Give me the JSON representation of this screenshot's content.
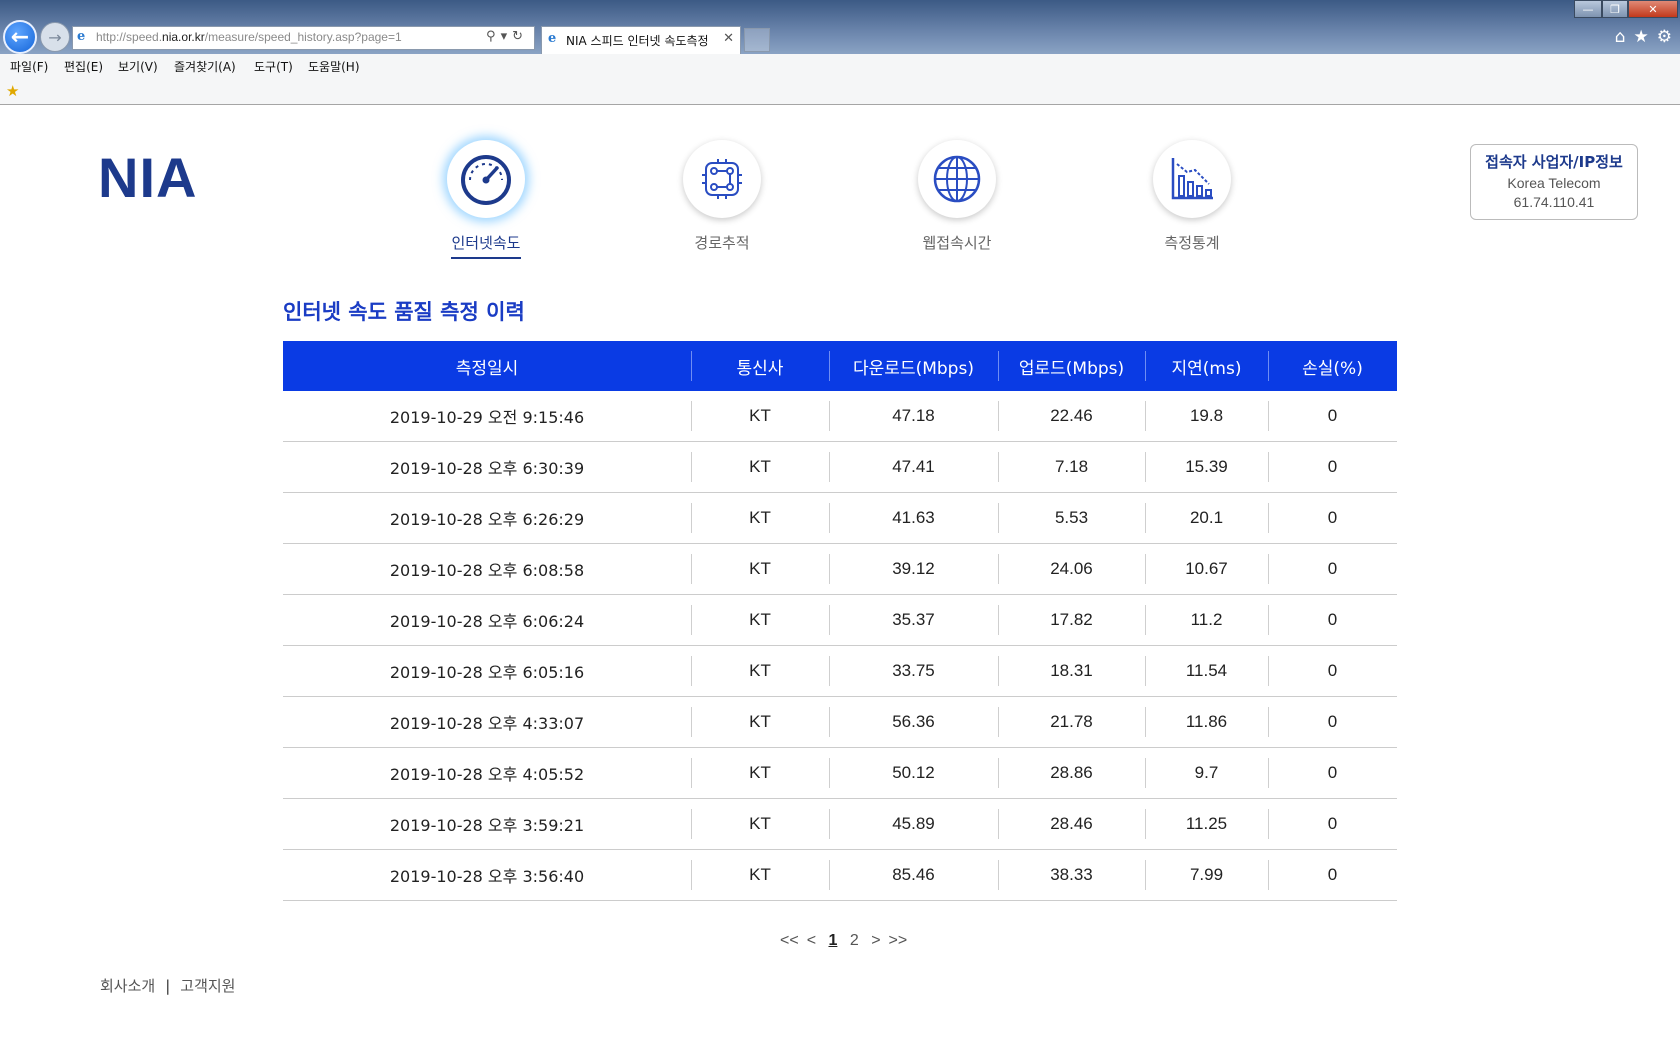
{
  "browser": {
    "url_prefix": "http://speed.",
    "url_domain": "nia.or.kr",
    "url_path": "/measure/speed_history.asp?page=1",
    "tab_title": "NIA 스피드 인터넷 속도측정",
    "menu": [
      "파일(F)",
      "편집(E)",
      "보기(V)",
      "즐겨찾기(A)",
      "도구(T)",
      "도움말(H)"
    ]
  },
  "page": {
    "logo": "NIA",
    "features": [
      {
        "label": "인터넷속도",
        "icon": "speedometer-icon",
        "active": true
      },
      {
        "label": "경로추적",
        "icon": "route-trace-icon",
        "active": false
      },
      {
        "label": "웹접속시간",
        "icon": "globe-icon",
        "active": false
      },
      {
        "label": "측정통계",
        "icon": "statistics-icon",
        "active": false
      }
    ],
    "info": {
      "title": "접속자 사업자/IP정보",
      "isp": "Korea Telecom",
      "ip": "61.74.110.41"
    },
    "section_title": "인터넷 속도 품질 측정 이력",
    "table": {
      "headers": [
        "측정일시",
        "통신사",
        "다운로드(Mbps)",
        "업로드(Mbps)",
        "지연(ms)",
        "손실(%)"
      ],
      "rows": [
        [
          "2019-10-29 오전 9:15:46",
          "KT",
          "47.18",
          "22.46",
          "19.8",
          "0"
        ],
        [
          "2019-10-28 오후 6:30:39",
          "KT",
          "47.41",
          "7.18",
          "15.39",
          "0"
        ],
        [
          "2019-10-28 오후 6:26:29",
          "KT",
          "41.63",
          "5.53",
          "20.1",
          "0"
        ],
        [
          "2019-10-28 오후 6:08:58",
          "KT",
          "39.12",
          "24.06",
          "10.67",
          "0"
        ],
        [
          "2019-10-28 오후 6:06:24",
          "KT",
          "35.37",
          "17.82",
          "11.2",
          "0"
        ],
        [
          "2019-10-28 오후 6:05:16",
          "KT",
          "33.75",
          "18.31",
          "11.54",
          "0"
        ],
        [
          "2019-10-28 오후 4:33:07",
          "KT",
          "56.36",
          "21.78",
          "11.86",
          "0"
        ],
        [
          "2019-10-28 오후 4:05:52",
          "KT",
          "50.12",
          "28.86",
          "9.7",
          "0"
        ],
        [
          "2019-10-28 오후 3:59:21",
          "KT",
          "45.89",
          "28.46",
          "11.25",
          "0"
        ],
        [
          "2019-10-28 오후 3:56:40",
          "KT",
          "85.46",
          "38.33",
          "7.99",
          "0"
        ]
      ]
    },
    "pager": {
      "first": "<<",
      "prev": "<",
      "pages": [
        "1",
        "2"
      ],
      "current": "1",
      "next": ">",
      "last": ">>"
    },
    "footer": {
      "about": "회사소개",
      "support": "고객지원"
    }
  }
}
